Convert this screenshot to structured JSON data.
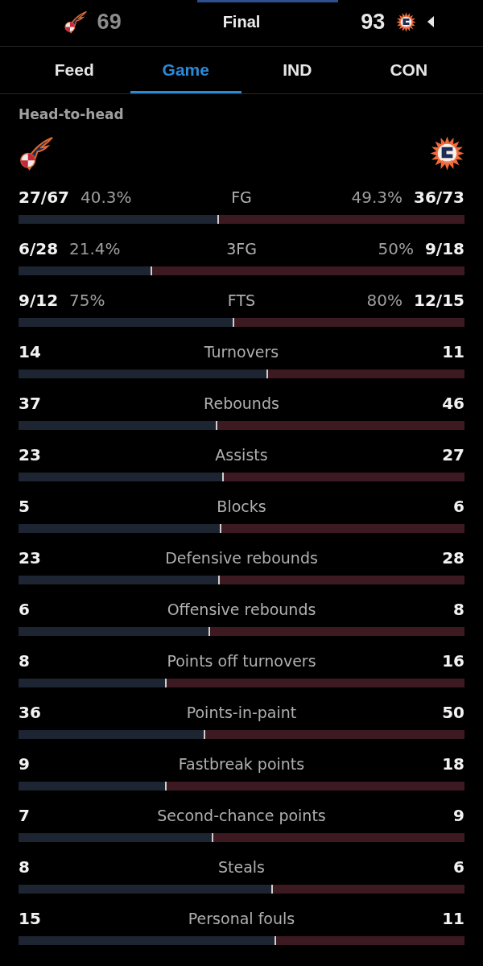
{
  "header": {
    "status": "Final",
    "teams": [
      {
        "score": "69",
        "winner": false
      },
      {
        "score": "93",
        "winner": true
      }
    ]
  },
  "tabs": [
    {
      "label": "Feed",
      "selected": false
    },
    {
      "label": "Game",
      "selected": true
    },
    {
      "label": "IND",
      "selected": false
    },
    {
      "label": "CON",
      "selected": false
    }
  ],
  "section": {
    "title": "Head-to-head"
  },
  "stats": [
    {
      "label": "FG",
      "home_value": "27/67",
      "home_pct": "40.3%",
      "away_pct": "49.3%",
      "away_value": "36/73",
      "level": 0.45
    },
    {
      "label": "3FG",
      "home_value": "6/28",
      "home_pct": "21.4%",
      "away_pct": "50%",
      "away_value": "9/18",
      "level": 0.3
    },
    {
      "label": "FTS",
      "home_value": "9/12",
      "home_pct": "75%",
      "away_pct": "80%",
      "away_value": "12/15",
      "level": 0.484
    },
    {
      "label": "Turnovers",
      "home_value": "14",
      "away_value": "11",
      "level": 0.56
    },
    {
      "label": "Rebounds",
      "home_value": "37",
      "away_value": "46",
      "level": 0.446
    },
    {
      "label": "Assists",
      "home_value": "23",
      "away_value": "27",
      "level": 0.46
    },
    {
      "label": "Blocks",
      "home_value": "5",
      "away_value": "6",
      "level": 0.455
    },
    {
      "label": "Defensive rebounds",
      "home_value": "23",
      "away_value": "28",
      "level": 0.451
    },
    {
      "label": "Offensive rebounds",
      "home_value": "6",
      "away_value": "8",
      "level": 0.429
    },
    {
      "label": "Points off turnovers",
      "home_value": "8",
      "away_value": "16",
      "level": 0.333
    },
    {
      "label": "Points-in-paint",
      "home_value": "36",
      "away_value": "50",
      "level": 0.419
    },
    {
      "label": "Fastbreak points",
      "home_value": "9",
      "away_value": "18",
      "level": 0.333
    },
    {
      "label": "Second-chance points",
      "home_value": "7",
      "away_value": "9",
      "level": 0.4375
    },
    {
      "label": "Steals",
      "home_value": "8",
      "away_value": "6",
      "level": 0.571
    },
    {
      "label": "Personal fouls",
      "home_value": "15",
      "away_value": "11",
      "level": 0.577
    }
  ]
}
